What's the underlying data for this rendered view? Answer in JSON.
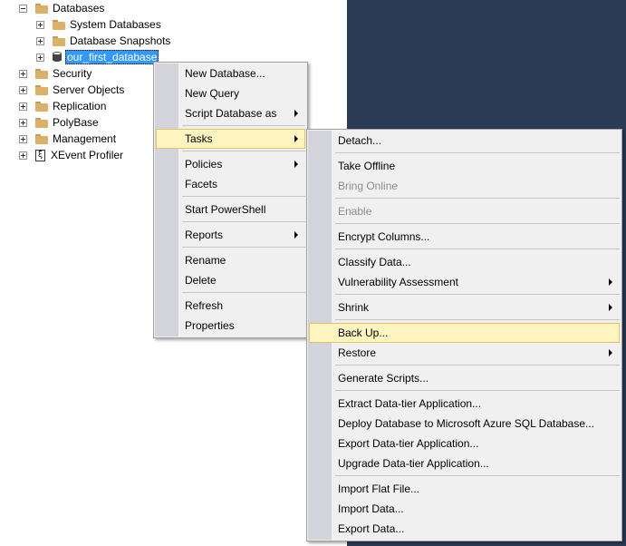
{
  "tree": {
    "databases": "Databases",
    "system_databases": "System Databases",
    "database_snapshots": "Database Snapshots",
    "selected_db": "our_first_database",
    "security": "Security",
    "server_objects": "Server Objects",
    "replication": "Replication",
    "polybase": "PolyBase",
    "management": "Management",
    "xevent_profiler": "XEvent Profiler"
  },
  "context_menu": {
    "new_database": "New Database...",
    "new_query": "New Query",
    "script_database_as": "Script Database as",
    "tasks": "Tasks",
    "policies": "Policies",
    "facets": "Facets",
    "start_powershell": "Start PowerShell",
    "reports": "Reports",
    "rename": "Rename",
    "delete": "Delete",
    "refresh": "Refresh",
    "properties": "Properties"
  },
  "tasks_menu": {
    "detach": "Detach...",
    "take_offline": "Take Offline",
    "bring_online": "Bring Online",
    "enable": "Enable",
    "encrypt_columns": "Encrypt Columns...",
    "classify_data": "Classify Data...",
    "vulnerability_assessment": "Vulnerability Assessment",
    "shrink": "Shrink",
    "back_up": "Back Up...",
    "restore": "Restore",
    "generate_scripts": "Generate Scripts...",
    "extract_data_tier": "Extract Data-tier Application...",
    "deploy_database_azure": "Deploy Database to Microsoft Azure SQL Database...",
    "export_data_tier": "Export Data-tier Application...",
    "upgrade_data_tier": "Upgrade Data-tier Application...",
    "import_flat_file": "Import Flat File...",
    "import_data": "Import Data...",
    "export_data": "Export Data..."
  }
}
